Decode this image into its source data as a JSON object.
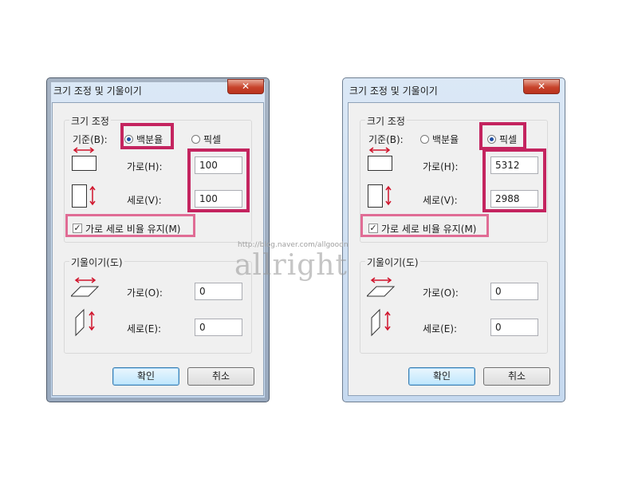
{
  "dialogs": [
    {
      "title": "크기 조정 및 기울이기",
      "close_label": "✕",
      "resize_group": "크기 조정",
      "basis_label": "기준(B):",
      "percent_label": "백분율",
      "pixel_label": "픽셀",
      "selected_basis": "백분율",
      "horizontal_label": "가로(H):",
      "horizontal_value": "100",
      "vertical_label": "세로(V):",
      "vertical_value": "100",
      "aspect_label": "가로 세로 비율 유지(M)",
      "aspect_checked": true,
      "skew_group": "기울이기(도)",
      "skew_h_label": "가로(O):",
      "skew_h_value": "0",
      "skew_v_label": "세로(E):",
      "skew_v_value": "0",
      "ok_label": "확인",
      "cancel_label": "취소"
    },
    {
      "title": "크기 조정 및 기울이기",
      "close_label": "✕",
      "resize_group": "크기 조정",
      "basis_label": "기준(B):",
      "percent_label": "백분율",
      "pixel_label": "픽셀",
      "selected_basis": "픽셀",
      "horizontal_label": "가로(H):",
      "horizontal_value": "5312",
      "vertical_label": "세로(V):",
      "vertical_value": "2988",
      "aspect_label": "가로 세로 비율 유지(M)",
      "aspect_checked": true,
      "skew_group": "기울이기(도)",
      "skew_h_label": "가로(O):",
      "skew_h_value": "0",
      "skew_v_label": "세로(E):",
      "skew_v_value": "0",
      "ok_label": "확인",
      "cancel_label": "취소"
    }
  ],
  "watermark": {
    "url": "http://blog.naver.com/allgoodn",
    "text": "allright"
  },
  "colors": {
    "highlight": "#c4245f",
    "highlight_light": "#e06c95",
    "arrow": "#d0142c"
  }
}
